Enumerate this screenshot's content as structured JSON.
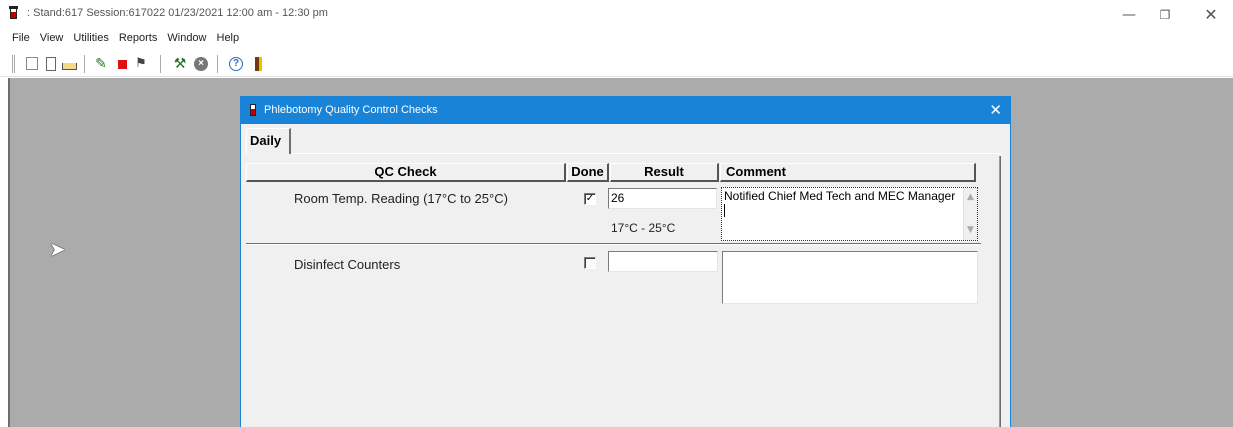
{
  "window": {
    "title": ": Stand:617 Session:617022 01/23/2021 12:00 am - 12:30 pm",
    "minimize": "—",
    "maximize": "❐",
    "close": "✕"
  },
  "menu": [
    "File",
    "View",
    "Utilities",
    "Reports",
    "Window",
    "Help"
  ],
  "toolbar": {
    "buttons": [
      "new-icon",
      "clipboard-icon",
      "open-folder-icon",
      "run-icon",
      "stop-icon",
      "flag-icon",
      "tools-icon",
      "cancel-icon",
      "help-icon",
      "exit-icon"
    ]
  },
  "dialog": {
    "title": "Phlebotomy Quality Control Checks",
    "close": "✕",
    "tab": "Daily",
    "headers": {
      "qc_check": "QC Check",
      "done": "Done",
      "result": "Result",
      "comment": "Comment"
    },
    "rows": [
      {
        "label": "Room Temp. Reading (17°C to 25°C)",
        "done": true,
        "done_mark": "✓",
        "result": "26",
        "range": "17°C - 25°C",
        "comment": "Notified Chief Med Tech and MEC Manager"
      },
      {
        "label": "Disinfect Counters",
        "done": false,
        "done_mark": "",
        "result": "",
        "range": "",
        "comment": ""
      }
    ]
  },
  "colors": {
    "dialog_titlebar": "#1883d7",
    "mdi_background": "#ababab",
    "stop_icon": "#e01010"
  }
}
